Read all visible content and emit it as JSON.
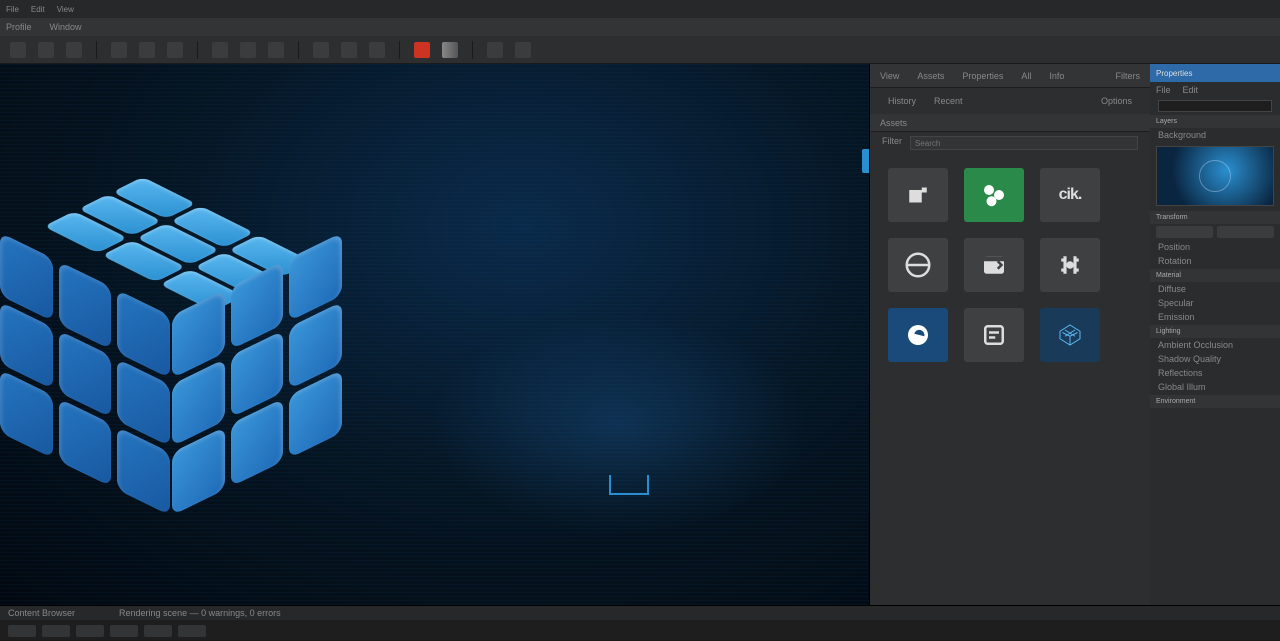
{
  "titlebar": {
    "items": [
      "File",
      "Edit",
      "View"
    ]
  },
  "menubar": {
    "items": [
      "Profile",
      "Window"
    ]
  },
  "toolbar": {
    "buttons": [
      "select",
      "move",
      "rotate",
      "sep",
      "snap",
      "grid",
      "align",
      "sep",
      "layer",
      "group",
      "lock",
      "sep",
      "play",
      "render",
      "export",
      "sep",
      "red",
      "grad",
      "sep",
      "zoom",
      "fit"
    ]
  },
  "right_header": {
    "tabs": [
      "View",
      "Assets",
      "Properties",
      "All",
      "Info"
    ],
    "right": "Filters"
  },
  "right_sub": {
    "tabs": [
      "History",
      "Recent"
    ],
    "right": "Options"
  },
  "asset_panel": {
    "header": "Assets",
    "filter_field": {
      "label": "Filter",
      "placeholder": "Search"
    },
    "cards": [
      {
        "name": "package",
        "type": "icon"
      },
      {
        "name": "shapes",
        "type": "green"
      },
      {
        "name": "cik",
        "type": "text",
        "label": "cik."
      },
      {
        "name": "disc",
        "type": "icon"
      },
      {
        "name": "window",
        "type": "icon"
      },
      {
        "name": "bracket",
        "type": "icon"
      },
      {
        "name": "sphere",
        "type": "blue"
      },
      {
        "name": "form",
        "type": "icon"
      },
      {
        "name": "mesh",
        "type": "bluemesh"
      }
    ]
  },
  "props": {
    "title": "Properties",
    "tabs": [
      "File",
      "Edit"
    ],
    "sections": [
      {
        "label": "Layers",
        "rows": [
          "Background"
        ]
      },
      {
        "label": "Transform",
        "rows": [
          "Position",
          "Rotation"
        ]
      },
      {
        "label": "Material",
        "rows": [
          "Diffuse",
          "Specular",
          "Emission"
        ]
      },
      {
        "label": "Lighting",
        "rows": [
          "Ambient Occlusion",
          "Shadow Quality",
          "Reflections",
          "Global Illum"
        ]
      },
      {
        "label": "Environment"
      }
    ],
    "search": {
      "placeholder": ""
    }
  },
  "bottom": {
    "tabs": [
      "Content Browser"
    ],
    "status": "Rendering scene — 0 warnings, 0 errors"
  }
}
